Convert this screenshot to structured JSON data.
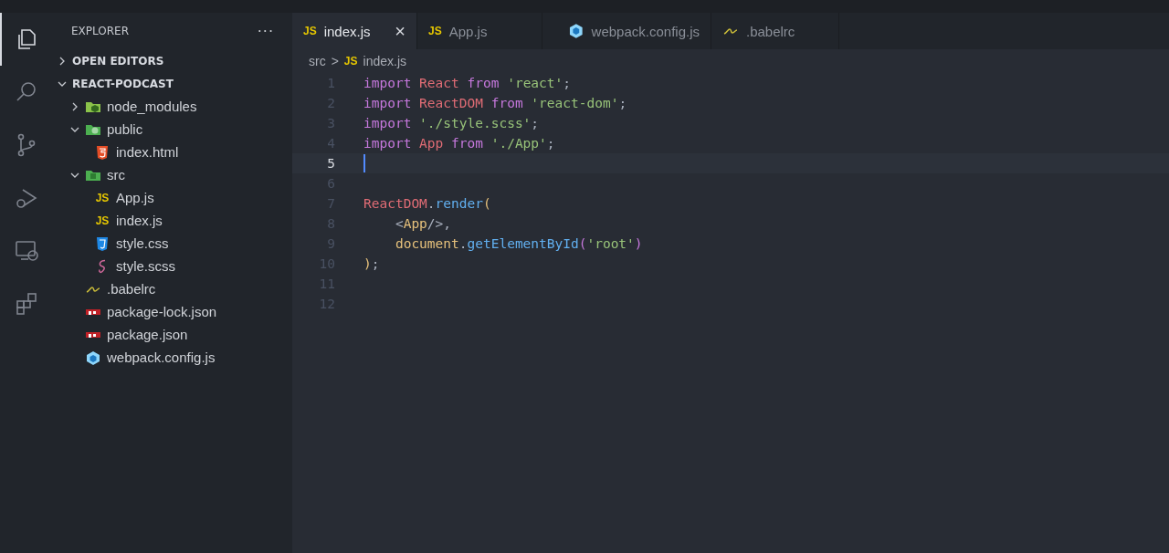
{
  "activity_bar": [
    {
      "kind": "files",
      "selected": true
    },
    {
      "kind": "search",
      "selected": false
    },
    {
      "kind": "source-control",
      "selected": false
    },
    {
      "kind": "run",
      "selected": false
    },
    {
      "kind": "remote",
      "selected": false
    },
    {
      "kind": "extensions",
      "selected": false
    }
  ],
  "sidebar": {
    "title": "EXPLORER",
    "more": "···",
    "sections": [
      {
        "label": "OPEN EDITORS",
        "expanded": false
      },
      {
        "label": "REACT-PODCAST",
        "expanded": true
      }
    ],
    "tree": [
      {
        "name": "node_modules",
        "kind": "folder-node",
        "expanded": false
      },
      {
        "name": "public",
        "kind": "folder-public",
        "expanded": true,
        "children": [
          {
            "name": "index.html",
            "kind": "html"
          }
        ]
      },
      {
        "name": "src",
        "kind": "folder-src",
        "expanded": true,
        "children": [
          {
            "name": "App.js",
            "badge": "JS"
          },
          {
            "name": "index.js",
            "badge": "JS"
          },
          {
            "name": "style.css",
            "kind": "css"
          },
          {
            "name": "style.scss",
            "kind": "sass"
          }
        ]
      },
      {
        "name": ".babelrc",
        "kind": "babel"
      },
      {
        "name": "package-lock.json",
        "kind": "npm"
      },
      {
        "name": "package.json",
        "kind": "npm"
      },
      {
        "name": "webpack.config.js",
        "kind": "webpack"
      }
    ]
  },
  "tabs": [
    {
      "label": "index.js",
      "badge": "JS",
      "selected": true,
      "close": "×"
    },
    {
      "label": "App.js",
      "badge": "JS",
      "selected": false
    },
    {
      "label": "webpack.config.js",
      "kind": "webpack",
      "selected": false
    },
    {
      "label": ".babelrc",
      "kind": "babel",
      "selected": false
    }
  ],
  "breadcrumb": {
    "folder": "src",
    "separator": ">",
    "file": "index.js",
    "badge": "JS"
  },
  "code": [
    {
      "number": "1",
      "current": false,
      "tokens": [
        {
          "kind": "kw",
          "text": "import"
        },
        {
          "kind": "var",
          "text": " React"
        },
        {
          "kind": "kw",
          "text": " from"
        },
        {
          "kind": "str",
          "text": " 'react'"
        },
        {
          "kind": "pl",
          "text": ";"
        }
      ]
    },
    {
      "number": "2",
      "current": false,
      "tokens": [
        {
          "kind": "kw",
          "text": "import"
        },
        {
          "kind": "var",
          "text": " ReactDOM"
        },
        {
          "kind": "kw",
          "text": " from"
        },
        {
          "kind": "str",
          "text": " 'react-dom'"
        },
        {
          "kind": "pl",
          "text": ";"
        }
      ]
    },
    {
      "number": "3",
      "current": false,
      "tokens": [
        {
          "kind": "kw",
          "text": "import"
        },
        {
          "kind": "str",
          "text": " './style.scss'"
        },
        {
          "kind": "pl",
          "text": ";"
        }
      ]
    },
    {
      "number": "4",
      "current": false,
      "tokens": [
        {
          "kind": "kw",
          "text": "import"
        },
        {
          "kind": "var",
          "text": " App"
        },
        {
          "kind": "kw",
          "text": " from"
        },
        {
          "kind": "str",
          "text": " './App'"
        },
        {
          "kind": "pl",
          "text": ";"
        }
      ]
    },
    {
      "number": "5",
      "current": true
    },
    {
      "number": "6",
      "current": false
    },
    {
      "number": "7",
      "current": false,
      "tokens": [
        {
          "kind": "var",
          "text": "ReactDOM"
        },
        {
          "kind": "pl",
          "text": "."
        },
        {
          "kind": "fn",
          "text": "render"
        },
        {
          "kind": "paren",
          "text": "("
        }
      ]
    },
    {
      "number": "8",
      "current": false,
      "tokens": [
        {
          "kind": "pl",
          "text": "    <"
        },
        {
          "kind": "obj",
          "text": "App"
        },
        {
          "kind": "pl",
          "text": "/>,"
        }
      ]
    },
    {
      "number": "9",
      "current": false,
      "tokens": [
        {
          "kind": "obj",
          "text": "    document"
        },
        {
          "kind": "pl",
          "text": "."
        },
        {
          "kind": "fn",
          "text": "getElementById"
        },
        {
          "kind": "paren2",
          "text": "("
        },
        {
          "kind": "str",
          "text": "'root'"
        },
        {
          "kind": "paren2",
          "text": ")"
        }
      ]
    },
    {
      "number": "10",
      "current": false,
      "tokens": [
        {
          "kind": "paren",
          "text": ")"
        },
        {
          "kind": "pl",
          "text": ";"
        }
      ]
    },
    {
      "number": "11",
      "current": false
    },
    {
      "number": "12",
      "current": false
    }
  ]
}
